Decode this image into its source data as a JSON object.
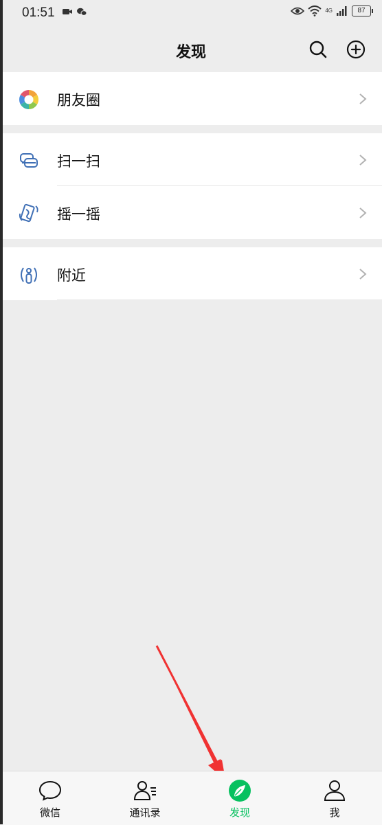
{
  "status_bar": {
    "time": "01:51",
    "battery": "87",
    "network_label": "4G"
  },
  "header": {
    "title": "发现",
    "search_icon": "search-icon",
    "add_icon": "plus-circle-icon"
  },
  "groups": [
    {
      "items": [
        {
          "label": "朋友圈",
          "icon": "moments-icon"
        }
      ]
    },
    {
      "items": [
        {
          "label": "扫一扫",
          "icon": "scan-icon"
        },
        {
          "label": "摇一摇",
          "icon": "shake-icon"
        }
      ]
    },
    {
      "items": [
        {
          "label": "附近",
          "icon": "nearby-icon"
        }
      ]
    }
  ],
  "tabs": [
    {
      "label": "微信",
      "icon": "chat-bubble-icon",
      "active": false
    },
    {
      "label": "通讯录",
      "icon": "contacts-icon",
      "active": false
    },
    {
      "label": "发现",
      "icon": "compass-icon",
      "active": true
    },
    {
      "label": "我",
      "icon": "person-icon",
      "active": false
    }
  ],
  "colors": {
    "accent": "#07c160",
    "background": "#ededed",
    "annotation_arrow": "#f03232"
  }
}
